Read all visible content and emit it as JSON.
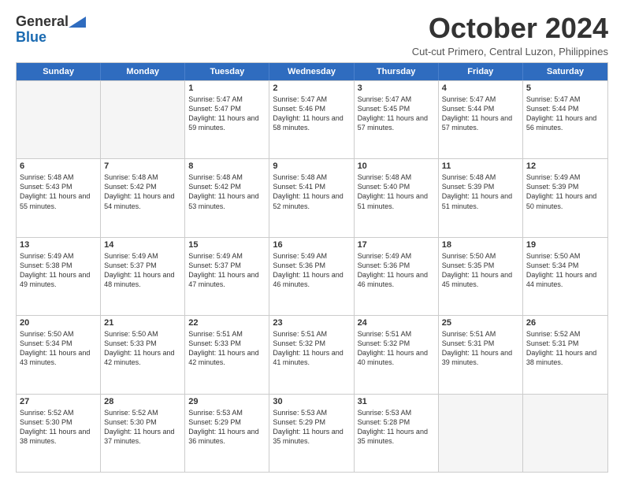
{
  "logo": {
    "line1": "General",
    "line2": "Blue"
  },
  "title": "October 2024",
  "subtitle": "Cut-cut Primero, Central Luzon, Philippines",
  "header_days": [
    "Sunday",
    "Monday",
    "Tuesday",
    "Wednesday",
    "Thursday",
    "Friday",
    "Saturday"
  ],
  "rows": [
    [
      {
        "day": "",
        "text": ""
      },
      {
        "day": "",
        "text": ""
      },
      {
        "day": "1",
        "text": "Sunrise: 5:47 AM\nSunset: 5:47 PM\nDaylight: 11 hours and 59 minutes."
      },
      {
        "day": "2",
        "text": "Sunrise: 5:47 AM\nSunset: 5:46 PM\nDaylight: 11 hours and 58 minutes."
      },
      {
        "day": "3",
        "text": "Sunrise: 5:47 AM\nSunset: 5:45 PM\nDaylight: 11 hours and 57 minutes."
      },
      {
        "day": "4",
        "text": "Sunrise: 5:47 AM\nSunset: 5:44 PM\nDaylight: 11 hours and 57 minutes."
      },
      {
        "day": "5",
        "text": "Sunrise: 5:47 AM\nSunset: 5:44 PM\nDaylight: 11 hours and 56 minutes."
      }
    ],
    [
      {
        "day": "6",
        "text": "Sunrise: 5:48 AM\nSunset: 5:43 PM\nDaylight: 11 hours and 55 minutes."
      },
      {
        "day": "7",
        "text": "Sunrise: 5:48 AM\nSunset: 5:42 PM\nDaylight: 11 hours and 54 minutes."
      },
      {
        "day": "8",
        "text": "Sunrise: 5:48 AM\nSunset: 5:42 PM\nDaylight: 11 hours and 53 minutes."
      },
      {
        "day": "9",
        "text": "Sunrise: 5:48 AM\nSunset: 5:41 PM\nDaylight: 11 hours and 52 minutes."
      },
      {
        "day": "10",
        "text": "Sunrise: 5:48 AM\nSunset: 5:40 PM\nDaylight: 11 hours and 51 minutes."
      },
      {
        "day": "11",
        "text": "Sunrise: 5:48 AM\nSunset: 5:39 PM\nDaylight: 11 hours and 51 minutes."
      },
      {
        "day": "12",
        "text": "Sunrise: 5:49 AM\nSunset: 5:39 PM\nDaylight: 11 hours and 50 minutes."
      }
    ],
    [
      {
        "day": "13",
        "text": "Sunrise: 5:49 AM\nSunset: 5:38 PM\nDaylight: 11 hours and 49 minutes."
      },
      {
        "day": "14",
        "text": "Sunrise: 5:49 AM\nSunset: 5:37 PM\nDaylight: 11 hours and 48 minutes."
      },
      {
        "day": "15",
        "text": "Sunrise: 5:49 AM\nSunset: 5:37 PM\nDaylight: 11 hours and 47 minutes."
      },
      {
        "day": "16",
        "text": "Sunrise: 5:49 AM\nSunset: 5:36 PM\nDaylight: 11 hours and 46 minutes."
      },
      {
        "day": "17",
        "text": "Sunrise: 5:49 AM\nSunset: 5:36 PM\nDaylight: 11 hours and 46 minutes."
      },
      {
        "day": "18",
        "text": "Sunrise: 5:50 AM\nSunset: 5:35 PM\nDaylight: 11 hours and 45 minutes."
      },
      {
        "day": "19",
        "text": "Sunrise: 5:50 AM\nSunset: 5:34 PM\nDaylight: 11 hours and 44 minutes."
      }
    ],
    [
      {
        "day": "20",
        "text": "Sunrise: 5:50 AM\nSunset: 5:34 PM\nDaylight: 11 hours and 43 minutes."
      },
      {
        "day": "21",
        "text": "Sunrise: 5:50 AM\nSunset: 5:33 PM\nDaylight: 11 hours and 42 minutes."
      },
      {
        "day": "22",
        "text": "Sunrise: 5:51 AM\nSunset: 5:33 PM\nDaylight: 11 hours and 42 minutes."
      },
      {
        "day": "23",
        "text": "Sunrise: 5:51 AM\nSunset: 5:32 PM\nDaylight: 11 hours and 41 minutes."
      },
      {
        "day": "24",
        "text": "Sunrise: 5:51 AM\nSunset: 5:32 PM\nDaylight: 11 hours and 40 minutes."
      },
      {
        "day": "25",
        "text": "Sunrise: 5:51 AM\nSunset: 5:31 PM\nDaylight: 11 hours and 39 minutes."
      },
      {
        "day": "26",
        "text": "Sunrise: 5:52 AM\nSunset: 5:31 PM\nDaylight: 11 hours and 38 minutes."
      }
    ],
    [
      {
        "day": "27",
        "text": "Sunrise: 5:52 AM\nSunset: 5:30 PM\nDaylight: 11 hours and 38 minutes."
      },
      {
        "day": "28",
        "text": "Sunrise: 5:52 AM\nSunset: 5:30 PM\nDaylight: 11 hours and 37 minutes."
      },
      {
        "day": "29",
        "text": "Sunrise: 5:53 AM\nSunset: 5:29 PM\nDaylight: 11 hours and 36 minutes."
      },
      {
        "day": "30",
        "text": "Sunrise: 5:53 AM\nSunset: 5:29 PM\nDaylight: 11 hours and 35 minutes."
      },
      {
        "day": "31",
        "text": "Sunrise: 5:53 AM\nSunset: 5:28 PM\nDaylight: 11 hours and 35 minutes."
      },
      {
        "day": "",
        "text": ""
      },
      {
        "day": "",
        "text": ""
      }
    ]
  ]
}
